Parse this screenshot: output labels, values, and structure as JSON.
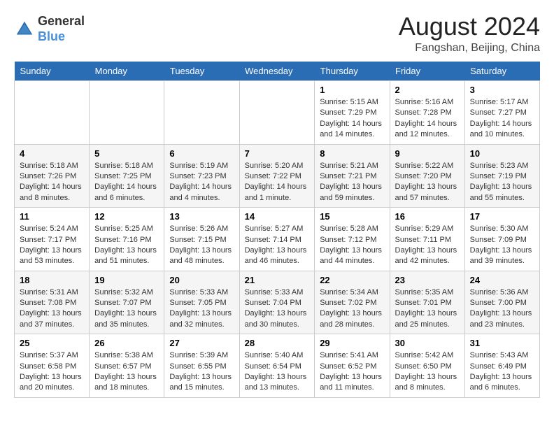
{
  "logo": {
    "general": "General",
    "blue": "Blue"
  },
  "title": {
    "month_year": "August 2024",
    "location": "Fangshan, Beijing, China"
  },
  "headers": [
    "Sunday",
    "Monday",
    "Tuesday",
    "Wednesday",
    "Thursday",
    "Friday",
    "Saturday"
  ],
  "weeks": [
    [
      {
        "day": "",
        "info": ""
      },
      {
        "day": "",
        "info": ""
      },
      {
        "day": "",
        "info": ""
      },
      {
        "day": "",
        "info": ""
      },
      {
        "day": "1",
        "info": "Sunrise: 5:15 AM\nSunset: 7:29 PM\nDaylight: 14 hours and 14 minutes."
      },
      {
        "day": "2",
        "info": "Sunrise: 5:16 AM\nSunset: 7:28 PM\nDaylight: 14 hours and 12 minutes."
      },
      {
        "day": "3",
        "info": "Sunrise: 5:17 AM\nSunset: 7:27 PM\nDaylight: 14 hours and 10 minutes."
      }
    ],
    [
      {
        "day": "4",
        "info": "Sunrise: 5:18 AM\nSunset: 7:26 PM\nDaylight: 14 hours and 8 minutes."
      },
      {
        "day": "5",
        "info": "Sunrise: 5:18 AM\nSunset: 7:25 PM\nDaylight: 14 hours and 6 minutes."
      },
      {
        "day": "6",
        "info": "Sunrise: 5:19 AM\nSunset: 7:23 PM\nDaylight: 14 hours and 4 minutes."
      },
      {
        "day": "7",
        "info": "Sunrise: 5:20 AM\nSunset: 7:22 PM\nDaylight: 14 hours and 1 minute."
      },
      {
        "day": "8",
        "info": "Sunrise: 5:21 AM\nSunset: 7:21 PM\nDaylight: 13 hours and 59 minutes."
      },
      {
        "day": "9",
        "info": "Sunrise: 5:22 AM\nSunset: 7:20 PM\nDaylight: 13 hours and 57 minutes."
      },
      {
        "day": "10",
        "info": "Sunrise: 5:23 AM\nSunset: 7:19 PM\nDaylight: 13 hours and 55 minutes."
      }
    ],
    [
      {
        "day": "11",
        "info": "Sunrise: 5:24 AM\nSunset: 7:17 PM\nDaylight: 13 hours and 53 minutes."
      },
      {
        "day": "12",
        "info": "Sunrise: 5:25 AM\nSunset: 7:16 PM\nDaylight: 13 hours and 51 minutes."
      },
      {
        "day": "13",
        "info": "Sunrise: 5:26 AM\nSunset: 7:15 PM\nDaylight: 13 hours and 48 minutes."
      },
      {
        "day": "14",
        "info": "Sunrise: 5:27 AM\nSunset: 7:14 PM\nDaylight: 13 hours and 46 minutes."
      },
      {
        "day": "15",
        "info": "Sunrise: 5:28 AM\nSunset: 7:12 PM\nDaylight: 13 hours and 44 minutes."
      },
      {
        "day": "16",
        "info": "Sunrise: 5:29 AM\nSunset: 7:11 PM\nDaylight: 13 hours and 42 minutes."
      },
      {
        "day": "17",
        "info": "Sunrise: 5:30 AM\nSunset: 7:09 PM\nDaylight: 13 hours and 39 minutes."
      }
    ],
    [
      {
        "day": "18",
        "info": "Sunrise: 5:31 AM\nSunset: 7:08 PM\nDaylight: 13 hours and 37 minutes."
      },
      {
        "day": "19",
        "info": "Sunrise: 5:32 AM\nSunset: 7:07 PM\nDaylight: 13 hours and 35 minutes."
      },
      {
        "day": "20",
        "info": "Sunrise: 5:33 AM\nSunset: 7:05 PM\nDaylight: 13 hours and 32 minutes."
      },
      {
        "day": "21",
        "info": "Sunrise: 5:33 AM\nSunset: 7:04 PM\nDaylight: 13 hours and 30 minutes."
      },
      {
        "day": "22",
        "info": "Sunrise: 5:34 AM\nSunset: 7:02 PM\nDaylight: 13 hours and 28 minutes."
      },
      {
        "day": "23",
        "info": "Sunrise: 5:35 AM\nSunset: 7:01 PM\nDaylight: 13 hours and 25 minutes."
      },
      {
        "day": "24",
        "info": "Sunrise: 5:36 AM\nSunset: 7:00 PM\nDaylight: 13 hours and 23 minutes."
      }
    ],
    [
      {
        "day": "25",
        "info": "Sunrise: 5:37 AM\nSunset: 6:58 PM\nDaylight: 13 hours and 20 minutes."
      },
      {
        "day": "26",
        "info": "Sunrise: 5:38 AM\nSunset: 6:57 PM\nDaylight: 13 hours and 18 minutes."
      },
      {
        "day": "27",
        "info": "Sunrise: 5:39 AM\nSunset: 6:55 PM\nDaylight: 13 hours and 15 minutes."
      },
      {
        "day": "28",
        "info": "Sunrise: 5:40 AM\nSunset: 6:54 PM\nDaylight: 13 hours and 13 minutes."
      },
      {
        "day": "29",
        "info": "Sunrise: 5:41 AM\nSunset: 6:52 PM\nDaylight: 13 hours and 11 minutes."
      },
      {
        "day": "30",
        "info": "Sunrise: 5:42 AM\nSunset: 6:50 PM\nDaylight: 13 hours and 8 minutes."
      },
      {
        "day": "31",
        "info": "Sunrise: 5:43 AM\nSunset: 6:49 PM\nDaylight: 13 hours and 6 minutes."
      }
    ]
  ]
}
